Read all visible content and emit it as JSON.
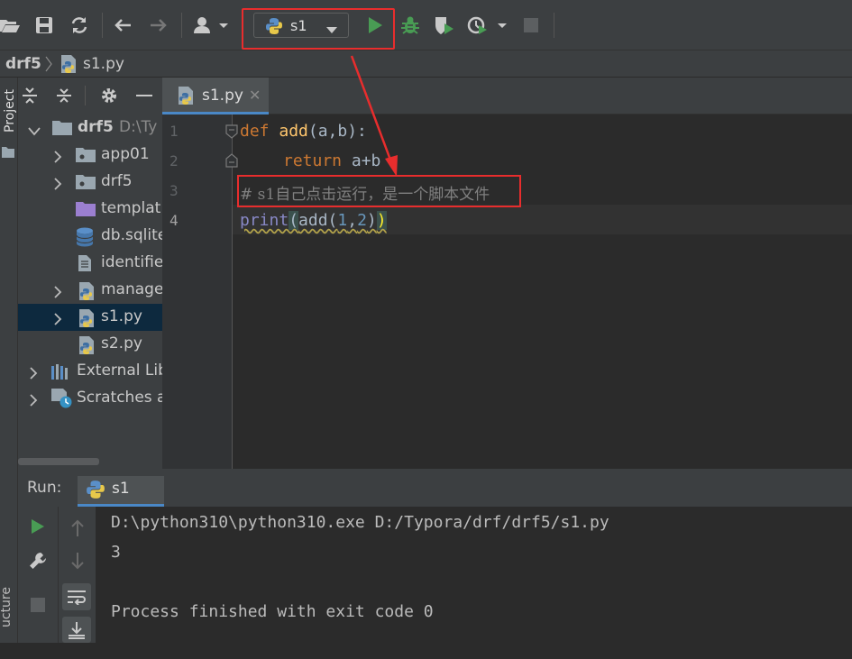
{
  "toolbar": {
    "run_config_name": "s1",
    "buttons": [
      "open-icon",
      "save-icon",
      "sync-icon",
      "back-icon",
      "forward-icon",
      "user-icon",
      "run-icon",
      "debug-icon",
      "coverage-icon",
      "profile-icon",
      "stop-icon"
    ]
  },
  "breadcrumb": {
    "project": "drf5",
    "file": "s1.py"
  },
  "stripe": {
    "project_label": "Project",
    "structure_label": "ucture"
  },
  "project_tree": {
    "root_name": "drf5",
    "root_path": "D:\\Ty",
    "items": [
      {
        "label": "app01",
        "icon": "folder-icon"
      },
      {
        "label": "drf5",
        "icon": "folder-icon"
      },
      {
        "label": "templat",
        "icon": "purple-folder-icon"
      },
      {
        "label": "db.sqlite",
        "icon": "database-icon"
      },
      {
        "label": "identifie",
        "icon": "file-icon"
      },
      {
        "label": "manage",
        "icon": "python-icon"
      },
      {
        "label": "s1.py",
        "icon": "python-icon"
      },
      {
        "label": "s2.py",
        "icon": "python-icon"
      }
    ],
    "external_libraries": "External Lib",
    "scratches": "Scratches a"
  },
  "editor": {
    "tab_label": "s1.py",
    "line_numbers": [
      "1",
      "2",
      "3",
      "4"
    ],
    "code": {
      "l1_def": "def ",
      "l1_name": "add",
      "l1_args": "(a,b):",
      "l2_return": "return ",
      "l2_expr": "a+b",
      "l3_comment": "# s1自己点击运行，是一个脚本文件",
      "l4_print": "print",
      "l4_open": "(",
      "l4_add": "add(",
      "l4_n1": "1",
      "l4_comma": ",",
      "l4_n2": "2",
      "l4_close1": ")",
      "l4_close2": ")"
    }
  },
  "run_panel": {
    "title": "Run:",
    "tab_label": "s1",
    "output": [
      "D:\\python310\\python310.exe D:/Typora/drf/drf5/s1.py",
      "3",
      "",
      "Process finished with exit code 0"
    ]
  },
  "colors": {
    "highlight": "#e82d2d",
    "run_green": "#499c54",
    "keyword": "#cc7832",
    "function": "#ffc66d"
  }
}
